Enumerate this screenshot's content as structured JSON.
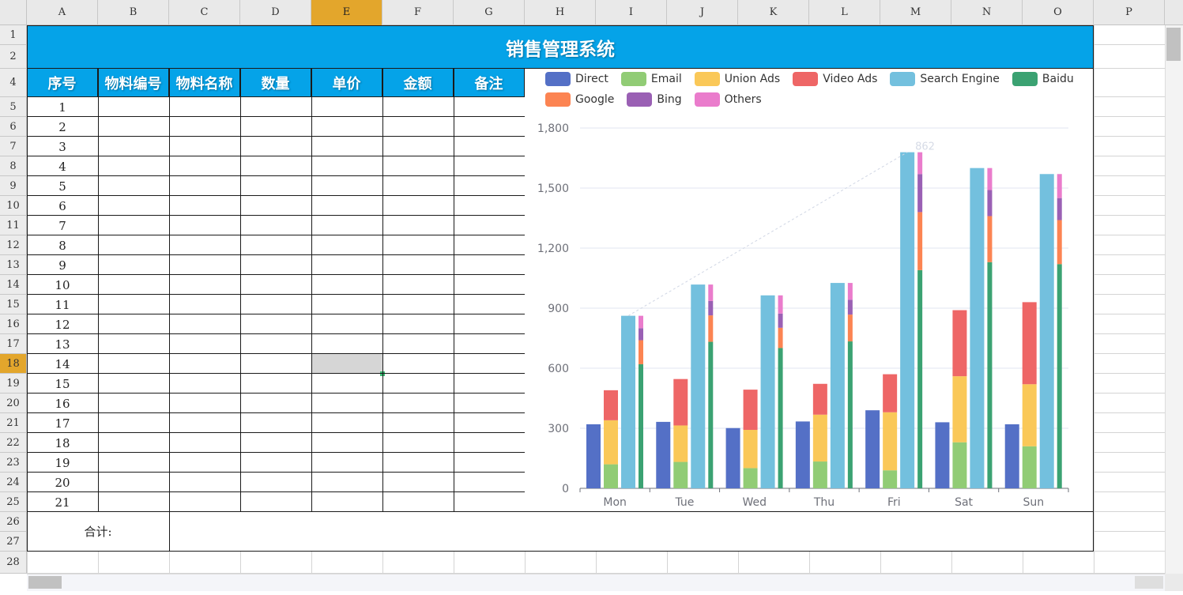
{
  "app": {
    "sheet_title": "销售管理系统",
    "columns": [
      "A",
      "B",
      "C",
      "D",
      "E",
      "F",
      "G",
      "H",
      "I",
      "J",
      "K",
      "L",
      "M",
      "N",
      "O",
      "P"
    ],
    "selected_column": "E",
    "selected_row": "18",
    "row_numbers": [
      "1",
      "2",
      "4",
      "5",
      "6",
      "7",
      "8",
      "9",
      "10",
      "11",
      "12",
      "13",
      "14",
      "15",
      "16",
      "17",
      "18",
      "19",
      "20",
      "21",
      "22",
      "23",
      "24",
      "25",
      "26",
      "27",
      "28"
    ]
  },
  "table": {
    "headers": [
      "序号",
      "物料编号",
      "物料名称",
      "数量",
      "单价",
      "金额",
      "备注"
    ],
    "seq": [
      "1",
      "2",
      "3",
      "4",
      "5",
      "6",
      "7",
      "8",
      "9",
      "10",
      "11",
      "12",
      "13",
      "14",
      "15",
      "16",
      "17",
      "18",
      "19",
      "20",
      "21"
    ],
    "total_label": "合计:"
  },
  "colors": {
    "title_bg": "#05a3e8",
    "selected_header": "#e3a62c",
    "selected_cell": "#d6d6d6"
  },
  "chart_data": {
    "type": "bar",
    "stacked": true,
    "categories": [
      "Mon",
      "Tue",
      "Wed",
      "Thu",
      "Fri",
      "Sat",
      "Sun"
    ],
    "ylim": [
      0,
      1800
    ],
    "yticks": [
      "0",
      "300",
      "600",
      "900",
      "1,200",
      "1,500",
      "1,800"
    ],
    "grid": true,
    "legend_position": "top",
    "annotation": "862",
    "series": [
      {
        "name": "Direct",
        "color": "#5470c6",
        "stack": "a",
        "values": [
          320,
          332,
          301,
          334,
          390,
          330,
          320
        ]
      },
      {
        "name": "Email",
        "color": "#91cc75",
        "stack": "b",
        "values": [
          120,
          132,
          101,
          134,
          90,
          230,
          210
        ]
      },
      {
        "name": "Union Ads",
        "color": "#fac858",
        "stack": "b",
        "values": [
          220,
          182,
          191,
          234,
          290,
          330,
          310
        ]
      },
      {
        "name": "Video Ads",
        "color": "#ee6666",
        "stack": "b",
        "values": [
          150,
          232,
          201,
          154,
          190,
          330,
          410
        ]
      },
      {
        "name": "Search Engine",
        "color": "#73c0de",
        "stack": "c",
        "values": [
          862,
          1018,
          964,
          1026,
          1679,
          1600,
          1570
        ]
      },
      {
        "name": "Baidu",
        "color": "#3ba272",
        "stack": "d",
        "values": [
          620,
          732,
          701,
          734,
          1090,
          1130,
          1120
        ]
      },
      {
        "name": "Google",
        "color": "#fc8452",
        "stack": "d",
        "values": [
          120,
          132,
          101,
          134,
          290,
          230,
          220
        ]
      },
      {
        "name": "Bing",
        "color": "#9a60b4",
        "stack": "d",
        "values": [
          60,
          72,
          71,
          74,
          190,
          130,
          110
        ]
      },
      {
        "name": "Others",
        "color": "#ea7ccc",
        "stack": "d",
        "values": [
          62,
          82,
          91,
          84,
          109,
          110,
          120
        ]
      }
    ]
  }
}
